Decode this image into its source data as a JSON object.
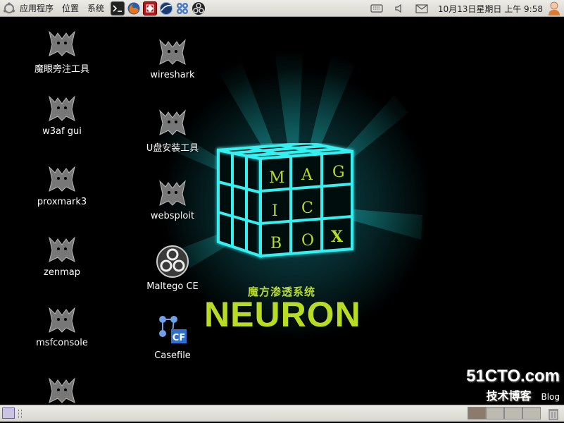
{
  "top_panel": {
    "menus": [
      "应用程序",
      "位置",
      "系统"
    ],
    "launchers": [
      "terminal-icon",
      "firefox-icon",
      "app-red-icon",
      "network-icon",
      "settings-icon",
      "backtrack-icon"
    ],
    "clock": "10月13日星期日 上午  9:58"
  },
  "desktop": {
    "icons_col1": [
      {
        "label": "魔眼旁注工具",
        "icon": "gargoyle-icon"
      },
      {
        "label": "w3af gui",
        "icon": "gargoyle-icon"
      },
      {
        "label": "proxmark3",
        "icon": "gargoyle-icon"
      },
      {
        "label": "zenmap",
        "icon": "gargoyle-icon"
      },
      {
        "label": "msfconsole",
        "icon": "gargoyle-icon"
      }
    ],
    "icons_col2": [
      {
        "label": "wireshark",
        "icon": "gargoyle-icon"
      },
      {
        "label": "U盘安装工具",
        "icon": "gargoyle-icon"
      },
      {
        "label": "websploit",
        "icon": "gargoyle-icon"
      },
      {
        "label": "Maltego CE",
        "icon": "maltego-icon"
      },
      {
        "label": "Casefile",
        "icon": "casefile-icon"
      }
    ]
  },
  "wallpaper": {
    "cube_letters": [
      "M",
      "A",
      "G",
      "I",
      "C",
      "B",
      "O",
      "X"
    ],
    "title_cn": "魔方渗透系统",
    "title": "NEURON",
    "accent_color": "#b7dc22",
    "glow_color": "#35f0f0"
  },
  "watermark": {
    "site": "51CTO.com",
    "sub": "技术博客",
    "blog": "Blog"
  }
}
